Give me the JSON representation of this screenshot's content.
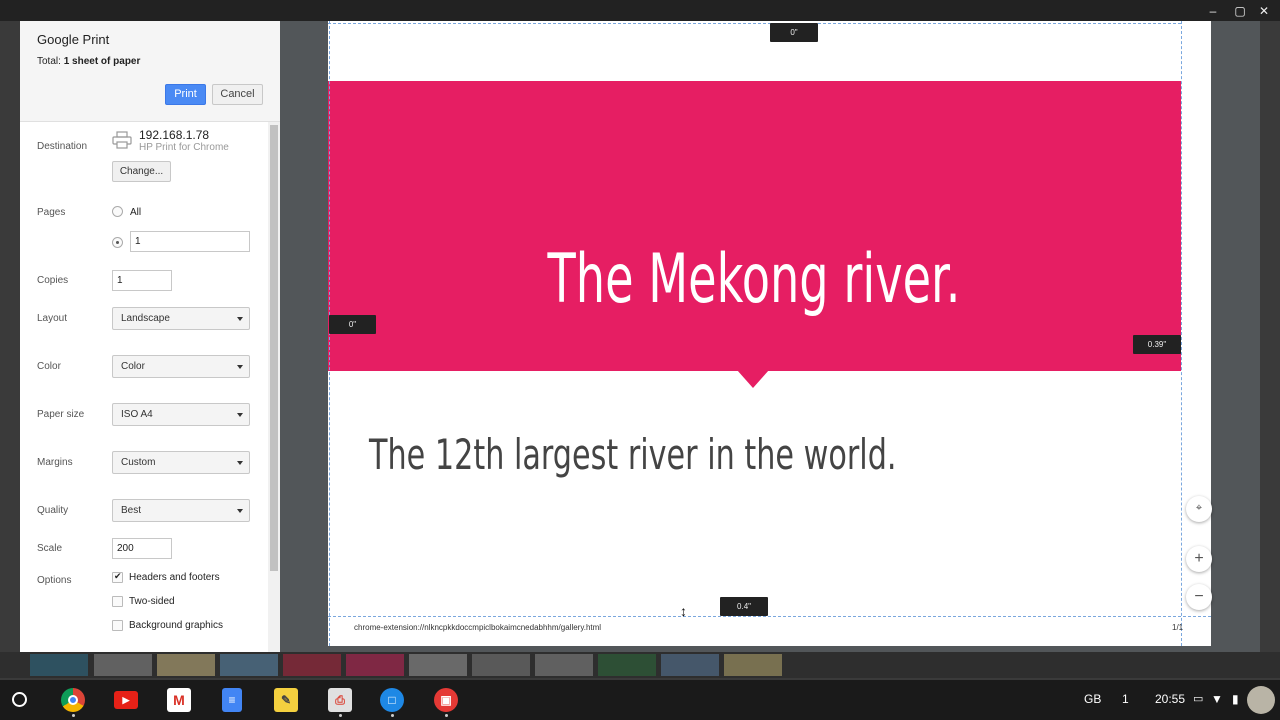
{
  "dialog": {
    "title": "Google Print",
    "total_prefix": "Total: ",
    "total_value": "1 sheet of paper",
    "print_label": "Print",
    "cancel_label": "Cancel"
  },
  "settings": {
    "destination": {
      "label": "Destination",
      "printer_name": "192.168.1.78",
      "printer_sub": "HP Print for Chrome",
      "change_label": "Change..."
    },
    "pages": {
      "label": "Pages",
      "all_label": "All",
      "custom_value": "1",
      "selected": "custom"
    },
    "copies": {
      "label": "Copies",
      "value": "1"
    },
    "layout": {
      "label": "Layout",
      "value": "Landscape"
    },
    "color": {
      "label": "Color",
      "value": "Color"
    },
    "paper_size": {
      "label": "Paper size",
      "value": "ISO A4"
    },
    "margins": {
      "label": "Margins",
      "value": "Custom"
    },
    "quality": {
      "label": "Quality",
      "value": "Best"
    },
    "scale": {
      "label": "Scale",
      "value": "200"
    },
    "options": {
      "label": "Options",
      "headers_footers": {
        "label": "Headers and footers",
        "checked": true
      },
      "two_sided": {
        "label": "Two-sided",
        "checked": false
      },
      "background_graphics": {
        "label": "Background graphics",
        "checked": false
      }
    }
  },
  "preview": {
    "headline": "The Mekong river.",
    "subline": "The 12th largest river in the world.",
    "banner_color": "#e61e63",
    "footer_url": "chrome-extension://nlkncpkkdoccmpiclbokaimcnedabhhm/gallery.html",
    "footer_page": "1/1",
    "margin_top": "0\"",
    "margin_left": "0\"",
    "margin_right": "0.39\"",
    "margin_bottom": "0.4\""
  },
  "zoom_controls": {
    "fit_icon": "fit-to-page-icon",
    "zoom_in": "+",
    "zoom_out": "−"
  },
  "shelf": {
    "apps": [
      "chrome-icon",
      "youtube-icon",
      "gmail-icon",
      "docs-icon",
      "keep-icon",
      "print-icon",
      "files-icon",
      "gallery-icon"
    ],
    "locale": "GB",
    "notifications": "1",
    "time": "20:55"
  }
}
